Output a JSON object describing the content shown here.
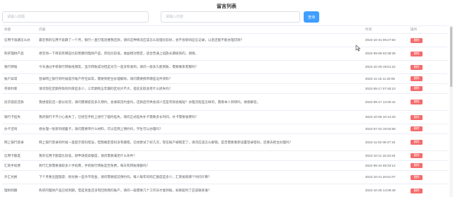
{
  "page": {
    "title": "留言列表"
  },
  "search": {
    "title_placeholder": "请输入标题",
    "content_placeholder": "请输入内容",
    "query_label": "查询"
  },
  "table": {
    "columns": [
      "标题",
      "内容",
      "时间",
      "操作"
    ],
    "delete_label": "删除",
    "rows": [
      {
        "title": "信用卡逾期怎么办",
        "content": "最近我的信用卡逾期了一个月，银行一直打电话催我还款，请问这种情况应该怎么处理比较好，会不会影响征信记录，以后还能不能办理贷款？",
        "time": "2022-10-31 09:27:50"
      },
      {
        "title": "购买理财产品",
        "content": "想咨询一下目前有哪些比较稳健的理财产品，风险比较低，收益相对稳定，适合普通上班族长期投资的，谢谢。",
        "time": "2022-09-08 02:38:28"
      },
      {
        "title": "银行转账",
        "content": "今天通过手机银行转账给朋友，显示转账成功但是对方一直没有收到，请问一般多久能到账，需要联系客服吗？",
        "time": "2022-10-29 19:51:22"
      },
      {
        "title": "账户异常",
        "content": "登录网上银行的时候提示账户存在异常，需要到柜台办理解除，请问需要携带哪些证件资料？",
        "time": "2022-11-15 11:20:05"
      },
      {
        "title": "存款利率",
        "content": "请问现在定期存款的利率是多少，三年期和五年期的区别大不大，提前支取会有什么损失吗？",
        "time": "2022-08-17 07:45:10"
      },
      {
        "title": "房贷提前还款",
        "content": "我想提前还一部分房贷，请问需要提前多久预约，会收取违约金吗，还款后月供会减少还是年限会缩短？办理流程是怎样的，需要本人到场吗，谢谢解答。",
        "time": "2022-09-17 13:30:42"
      },
      {
        "title": "银行卡挂失",
        "content": "我的银行卡不小心丢失了，已经在手机上进行了临时挂失，请问正式挂失补卡需要多长时间，补卡需要收费吗？",
        "time": "2022-10-05 10:14:33"
      },
      {
        "title": "办卡咨询",
        "content": "想办理一张新的储蓄卡，请问需要带什么材料，可以在网上预约吗，学生可以办理吗？",
        "time": "2022-07-22 16:02:59"
      },
      {
        "title": "网上银行登录",
        "content": "网上银行登录的时候一直提示密码错误，但我确定密码没有输错，已经尝试了好几次，现在账户被锁定了，请问应该怎么解锁，是否需要重新设置登录密码，还要去柜台办理吗？",
        "time": "2022-11-02 08:47:15"
      },
      {
        "title": "信用卡额度",
        "content": "我的信用卡额度比较低，想申请提高额度，请问需要满足什么条件？",
        "time": "2022-10-11 18:23:40"
      },
      {
        "title": "汇款手续费",
        "content": "跨行汇款需要收取多少手续费，手机银行转账是否免费，每天有转账限额吗？",
        "time": "2022-06-24 09:33:12"
      },
      {
        "title": "外汇兑换",
        "content": "下个月要出国旅游，想兑换一些外币现金，请问需要提前预约吗，每人每年的购汇额度是多少，汇率按照哪个时间计算？",
        "time": "2022-10-21 20:51:07"
      },
      {
        "title": "理财到期",
        "content": "购买的理财产品已经到期，但是资金还没有回到我的账户，请问一般需要几个工作日才能到账，如果超时了应该联系谁？",
        "time": "2022-10-25 14:09:48"
      }
    ]
  },
  "colors": {
    "accent": "#409eff",
    "danger": "#f56c6c",
    "border": "#ebeef5"
  },
  "icons": {
    "cursor": "mouse-pointer-icon"
  }
}
